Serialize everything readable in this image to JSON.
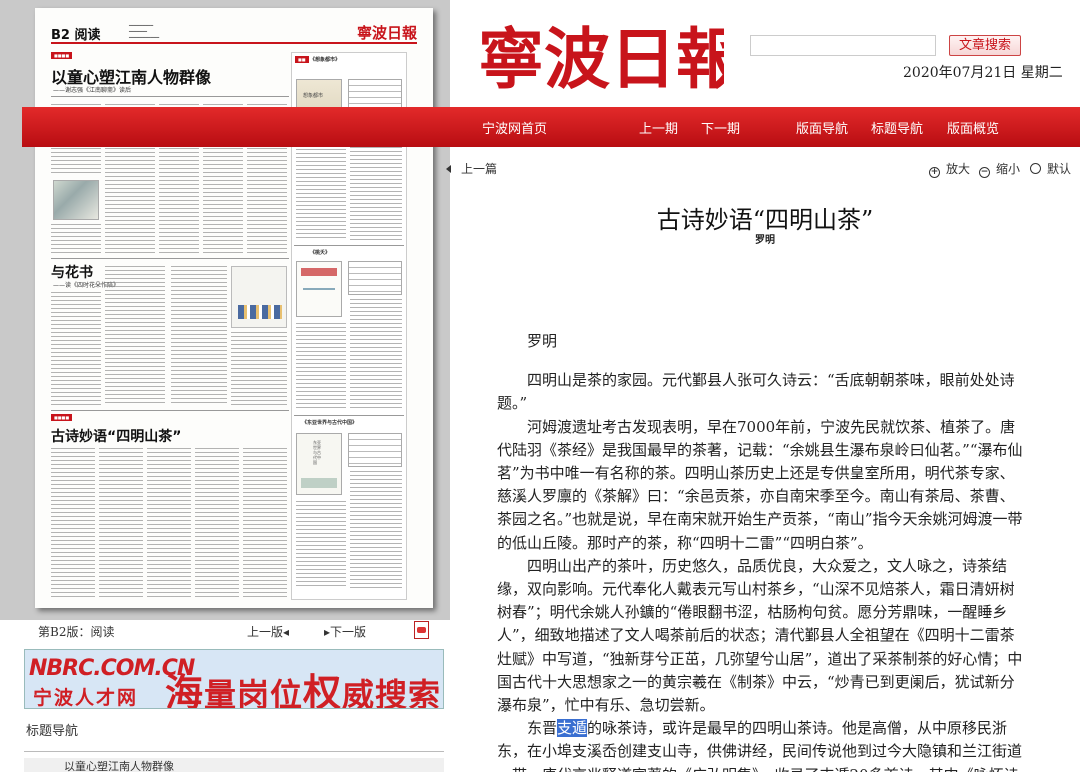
{
  "masthead": {
    "logo_text": "寧波日報",
    "search_placeholder": "",
    "search_button": "文章搜索",
    "date": "2020年07月21日  星期二"
  },
  "topnav": {
    "items": [
      "宁波网首页",
      "上一期",
      "下一期",
      "版面导航",
      "标题导航",
      "版面概览"
    ]
  },
  "toolbar": {
    "prev_article": "上一篇",
    "zoom_in": "放大",
    "zoom_out": "缩小",
    "default": "默认"
  },
  "article": {
    "title": "古诗妙语“四明山茶”",
    "author": "罗明",
    "byline": "罗明",
    "paragraphs": [
      "四明山是茶的家园。元代鄞县人张可久诗云：“舌底朝朝茶味，眼前处处诗题。”",
      "河姆渡遗址考古发现表明，早在7000年前，宁波先民就饮茶、植茶了。唐代陆羽《茶经》是我国最早的茶著，记载：“余姚县生瀑布泉岭曰仙茗。”“瀑布仙茗”为书中唯一有名称的茶。四明山茶历史上还是专供皇室所用，明代茶专家、慈溪人罗廪的《茶解》曰：“余邑贡茶，亦自南宋季至今。南山有茶局、茶曹、茶园之名。”也就是说，早在南宋就开始生产贡茶，“南山”指今天余姚河姆渡一带的低山丘陵。那时产的茶，称“四明十二雷”“四明白茶”。",
      "四明山出产的茶叶，历史悠久，品质优良，大众爱之，文人咏之，诗茶结缘，双向影响。元代奉化人戴表元写山村茶乡，“山深不见焙茶人，霜日清妍树树春”；明代余姚人孙鑛的“倦眼翻书涩，枯肠枸句贫。愿分芳鼎味，一醒睡乡人”，细致地描述了文人喝茶前后的状态；清代鄞县人全祖望在《四明十二雷茶灶赋》中写道，“独新芽兮正茁，几弥望兮山居”，道出了采茶制茶的好心情；中国古代十大思想家之一的黄宗羲在《制茶》中云，“炒青已到更阑后，犹试新分瀑布泉”，忙中有乐、急切尝新。"
    ],
    "last_para": {
      "pre": "东晋",
      "highlight": "支遁",
      "post": "的咏茶诗，或许是最早的四明山茶诗。他是高僧，从中原移民浙东，在小埠支溪岙创建支山寺，供佛讲经，民间传说他到过今大隐镇和兰江街道一带。唐代京兆释道宣著的《广弘明集》，收录了支遁20多首诗，其中《咏怀诗五首"
    }
  },
  "paper": {
    "page_label": "B2 阅读",
    "masthead": "寧波日報",
    "headline1": "以童心塑江南人物群像",
    "subhead1": "——谢志强《江南聊斋》读后",
    "headline2": "与花书",
    "subhead2": "——读《四时花朵作陪》",
    "headline3": "古诗妙语“四明山茶”",
    "side_title1": "《想象都市》",
    "side_title2": "《桃夭》",
    "side_title3": "《东亚世界与古代中国》",
    "book1_title": "想象都市",
    "book3_title": "东亚世界与古代中国"
  },
  "paper_nav": {
    "current": "第B2版：阅读",
    "prev": "上一版",
    "next": "下一版"
  },
  "ad": {
    "brand_en": "NBRC.COM.CN",
    "brand_cn": "宁波人才网",
    "slogan_1": "海",
    "slogan_2": "量岗位",
    "slogan_3": "权",
    "slogan_4": "威搜索"
  },
  "title_nav": {
    "label": "标题导航",
    "first_item": "以童心塑江南人物群像"
  }
}
